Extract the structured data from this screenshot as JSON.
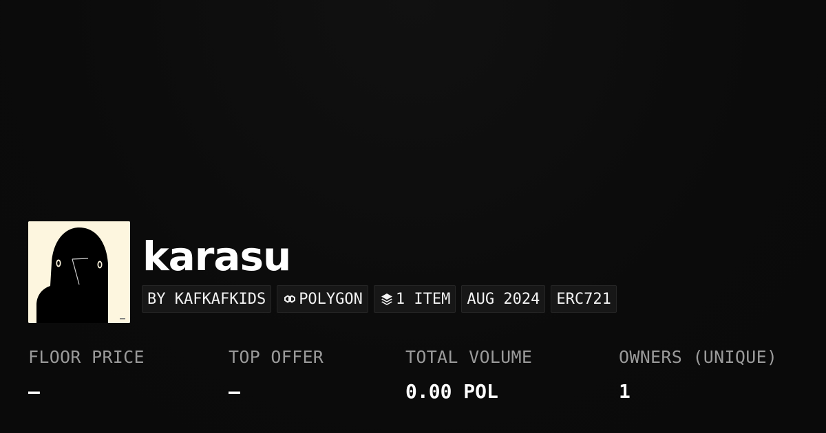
{
  "collection": {
    "name": "karasu"
  },
  "badges": {
    "creator": "BY KAFKAFKIDS",
    "chain": "POLYGON",
    "items": "1 ITEM",
    "date": "AUG 2024",
    "standard": "ERC721",
    "chain_icon": "polygon-link-icon",
    "items_icon": "layers-icon"
  },
  "stats": {
    "floor_price": {
      "label": "FLOOR PRICE",
      "value": "–"
    },
    "top_offer": {
      "label": "TOP OFFER",
      "value": "–"
    },
    "total_volume": {
      "label": "TOTAL VOLUME",
      "value": "0.00 POL"
    },
    "owners": {
      "label": "OWNERS (UNIQUE)",
      "value": "1"
    }
  },
  "colors": {
    "background": "#0a0a0a",
    "badge_bg": "#171717",
    "label_gray": "#9a9a9a",
    "avatar_bg": "#fdf6df"
  }
}
